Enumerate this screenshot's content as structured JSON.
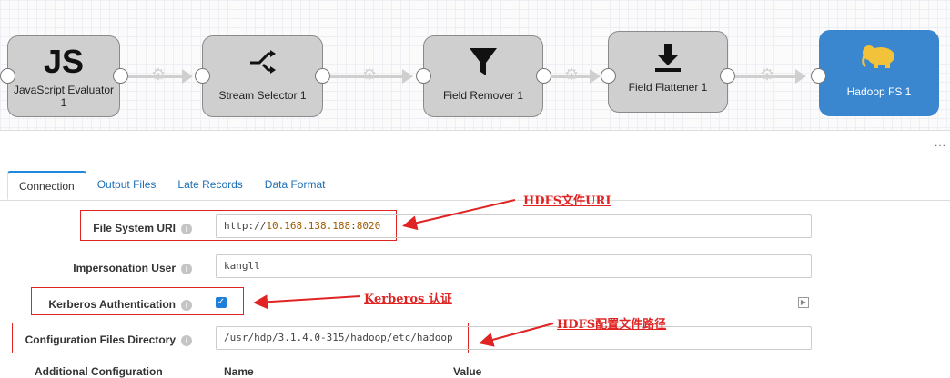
{
  "pipeline": {
    "stages": [
      {
        "label": "JavaScript Evaluator 1",
        "icon": "js-icon",
        "icon_text": "JS"
      },
      {
        "label": "Stream Selector 1",
        "icon": "shuffle-icon"
      },
      {
        "label": "Field Remover 1",
        "icon": "funnel-icon"
      },
      {
        "label": "Field Flattener 1",
        "icon": "download-icon"
      },
      {
        "label": "Hadoop FS 1",
        "icon": "hadoop-elephant-icon"
      }
    ]
  },
  "panel": {
    "more": "...",
    "tabs": [
      "Connection",
      "Output Files",
      "Late Records",
      "Data Format"
    ],
    "active_tab": "Connection"
  },
  "form": {
    "file_system_uri": {
      "label": "File System URI",
      "value": "http://10.168.138.188:8020"
    },
    "impersonation_user": {
      "label": "Impersonation User",
      "value": "kangll"
    },
    "kerberos": {
      "label": "Kerberos Authentication",
      "checked": true
    },
    "config_dir": {
      "label": "Configuration Files Directory",
      "value": "/usr/hdp/3.1.4.0-315/hadoop/etc/hadoop"
    },
    "additional_config": {
      "label": "Additional Configuration",
      "col_name": "Name",
      "col_value": "Value"
    }
  },
  "annotations": {
    "hdfs_uri": "HDFS文件URI",
    "kerberos": "Kerberos 认证",
    "hdfs_config": "HDFS配置文件路径"
  },
  "colors": {
    "accent": "#1f88d8",
    "annotation": "#e02424",
    "destination": "#3a86cf"
  }
}
